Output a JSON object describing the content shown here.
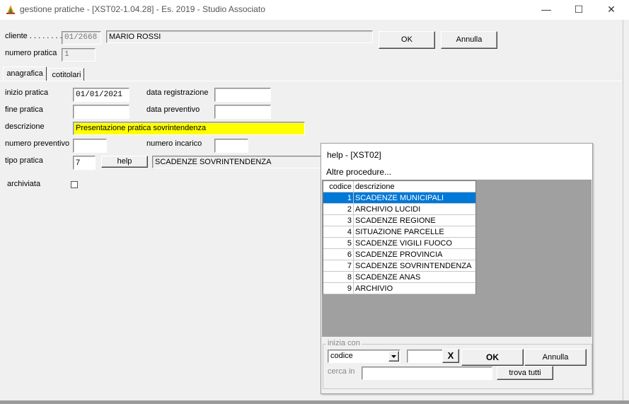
{
  "window": {
    "title": "gestione pratiche - [XST02-1.04.28] - Es. 2019 - Studio Associato",
    "minimize": "—",
    "maximize": "☐",
    "close": "✕"
  },
  "header": {
    "cliente_label": "cliente . . . . . . . .",
    "cliente_code": "01/2668",
    "cliente_name": "MARIO ROSSI",
    "numero_pratica_label": "numero pratica",
    "numero_pratica_value": "1",
    "ok_label": "OK",
    "annulla_label": "Annulla"
  },
  "tabs": [
    {
      "label": "anagrafica",
      "active": true
    },
    {
      "label": "cotitolari",
      "active": false
    }
  ],
  "form": {
    "inizio_pratica_label": "inizio pratica",
    "inizio_pratica_value": "01/01/2021",
    "data_registrazione_label": "data registrazione",
    "data_registrazione_value": "",
    "fine_pratica_label": "fine pratica",
    "fine_pratica_value": "",
    "data_preventivo_label": "data preventivo",
    "data_preventivo_value": "",
    "descrizione_label": "descrizione",
    "descrizione_value": "Presentazione pratica sovrintendenza",
    "descrizione_bg": "#ffff00",
    "numero_preventivo_label": "numero preventivo",
    "numero_preventivo_value": "",
    "numero_incarico_label": "numero incarico",
    "numero_incarico_value": "",
    "tipo_pratica_label": "tipo pratica",
    "tipo_pratica_value": "7",
    "help_label": "help",
    "tipo_pratica_desc": "SCADENZE SOVRINTENDENZA",
    "archiviata_label": "archiviata",
    "archiviata_checked": false
  },
  "help_dialog": {
    "title": "help - [XST02]",
    "subtitle": "Altre procedure...",
    "columns": [
      "codice",
      "descrizione"
    ],
    "rows": [
      {
        "codice": "1",
        "descrizione": "SCADENZE MUNICIPALI",
        "selected": true
      },
      {
        "codice": "2",
        "descrizione": "ARCHIVIO LUCIDI",
        "selected": false
      },
      {
        "codice": "3",
        "descrizione": "SCADENZE REGIONE",
        "selected": false
      },
      {
        "codice": "4",
        "descrizione": "SITUAZIONE PARCELLE",
        "selected": false
      },
      {
        "codice": "5",
        "descrizione": "SCADENZE VIGILI FUOCO",
        "selected": false
      },
      {
        "codice": "6",
        "descrizione": "SCADENZE PROVINCIA",
        "selected": false
      },
      {
        "codice": "7",
        "descrizione": "SCADENZE SOVRINTENDENZA",
        "selected": false
      },
      {
        "codice": "8",
        "descrizione": "SCADENZE ANAS",
        "selected": false
      },
      {
        "codice": "9",
        "descrizione": "ARCHIVIO",
        "selected": false
      }
    ],
    "group_label": "inizia con",
    "search_field_selected": "codice",
    "search_value": "",
    "clear_label": "X",
    "ok_label": "OK",
    "annulla_label": "Annulla",
    "cerca_in_label": "cerca in",
    "cerca_in_value": "",
    "trova_tutti_label": "trova tutti",
    "selection_color": "#0078d7"
  }
}
